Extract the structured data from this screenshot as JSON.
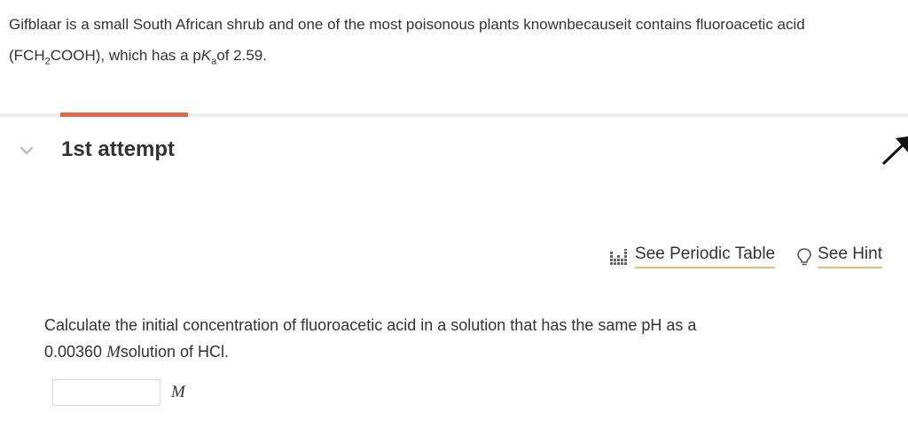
{
  "intro": {
    "part1": "Gifblaar is a small South African shrub and one of the most poisonous plants knownbecauseit contains fluoroacetic acid (FCH",
    "sub1": "2",
    "part2": "COOH), which has a p",
    "k": "K",
    "ksub": "a",
    "part3": "of 2.59."
  },
  "attempt": {
    "title": "1st attempt"
  },
  "tools": {
    "periodic_table": "See Periodic Table",
    "hint": "See Hint"
  },
  "question": {
    "text1": "Calculate the initial concentration of fluoroacetic acid in a solution that has the same pH as a ",
    "value": "0.00360",
    "unit": "M",
    "text2": "solution of HCl."
  },
  "answer": {
    "value": "",
    "unit": "M"
  },
  "colors": {
    "accent": "#e0694a",
    "link_underline": "#f2b86d",
    "divider": "#ececec",
    "text": "#333333"
  },
  "icons": {
    "collapse": "chevron-down-icon",
    "periodic_table": "periodic-table-icon",
    "hint": "lightbulb-icon",
    "corner": "arrow-corner-icon"
  }
}
